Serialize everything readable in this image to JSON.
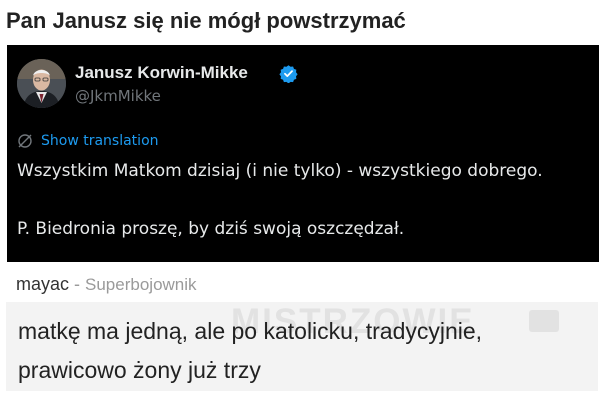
{
  "post": {
    "title": "Pan Janusz się nie mógł powstrzymać"
  },
  "tweet": {
    "author_name": "Janusz Korwin-Mikke",
    "author_handle": "@JkmMikke",
    "verified": true,
    "translate_label": "Show translation",
    "text_line_1": "Wszystkim Matkom dzisiaj (i nie tylko) - wszystkiego dobrego.",
    "text_line_2": "P. Biedronia proszę, by dziś swoją oszczędzał.",
    "colors": {
      "background": "#000000",
      "text": "#e7e9ea",
      "handle": "#71767b",
      "link": "#1d9bf0",
      "verified_badge": "#1d9bf0"
    },
    "icons": {
      "verified": "verified-badge-icon",
      "translate": "globe-slash-icon"
    }
  },
  "comment": {
    "username": "mayac",
    "separator": " - ",
    "rank": "Superbojownik",
    "text_line_1": "matkę ma jedną, ale po katolicku, tradycyjnie,",
    "text_line_2": "prawicowo żony już trzy",
    "watermark": "MISTRZOWIE",
    "colors": {
      "background": "#f3f3f3",
      "text": "#222222",
      "rank": "#9a9a9a"
    }
  }
}
